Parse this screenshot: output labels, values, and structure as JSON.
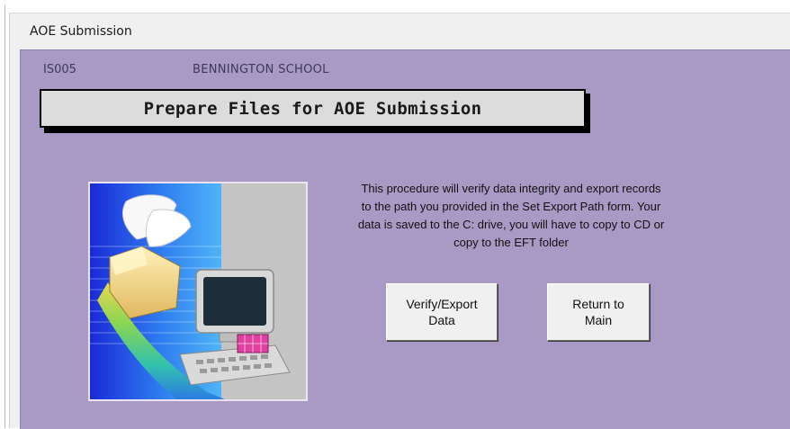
{
  "window": {
    "title": "AOE Submission"
  },
  "form": {
    "school_id": "IS005",
    "school_name": "BENNINGTON SCHOOL",
    "banner_title": "Prepare Files for AOE Submission",
    "description": "This procedure will verify data integrity and export records to the path you provided in the Set Export Path form.  Your data  is saved to the C: drive, you will have to copy to CD or copy to the EFT folder",
    "illustration_icon": "document-to-computer-icon",
    "buttons": {
      "verify_label": "Verify/Export\nData",
      "return_label": "Return to\nMain"
    }
  },
  "colors": {
    "form_background": "#a89ac4",
    "window_background": "#f0f0f0",
    "banner_background": "#dcdcdc"
  }
}
